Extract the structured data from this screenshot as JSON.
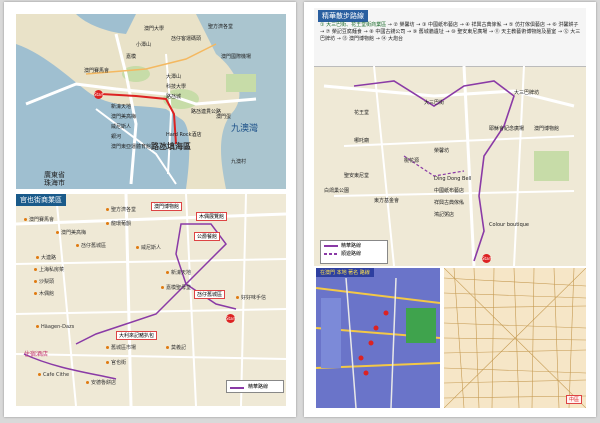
{
  "map1": {
    "sea_label": "九澳灣",
    "region_label_1": "廣東省",
    "region_label_2": "珠海市",
    "district_label": "路氹填海區",
    "places": [
      "澳門賽馬會",
      "氹仔客運碼頭",
      "澳門大學",
      "聖方濟各堂",
      "新濠天地",
      "澳門美高梅",
      "威尼斯人",
      "銀河",
      "Hard Rock酒店",
      "澳門國際機場",
      "大潭山",
      "科技大學",
      "路氹城",
      "九澳村",
      "嘉模",
      "小潭山",
      "澳門東亞運體育館",
      "路氹連貫公路",
      "澳門蛋"
    ],
    "start_label": "Start"
  },
  "map2": {
    "title": "官也街商業區",
    "places": [
      "澳門賽馬會",
      "澳門美高梅",
      "氹仔舊城區",
      "大連路",
      "上海私房菜",
      "沙梨頭",
      "木偶館",
      "Häagen-Dazs",
      "Cafe Cithe",
      "聖方濟各堂",
      "龍環葡韻",
      "威尼斯人",
      "新濠天地",
      "嘉模聖母堂",
      "大利來記豬扒包",
      "好好味手信",
      "舊城區市場",
      "莫義記",
      "官也街",
      "安德魯餅店"
    ],
    "boxed": [
      "澳門博物館",
      "木偶展覽館",
      "公爵餐館",
      "氹仔舊城區",
      "大利來記豬扒包"
    ],
    "hotel_label": "住宿酒店",
    "legend": "精華路線",
    "start_label": "Start"
  },
  "map3": {
    "title": "精華散步路線",
    "stops": [
      "大三巴街、花王堂街商業區",
      "榮馨坊",
      "中國紙布藝店",
      "祥興古典傢俬",
      "仿打傢俱藝店",
      "洪馨餅子",
      "榮記豆腐麵食",
      "中國古錢公司",
      "舊城牆遺址",
      "聖安東尼廣場",
      "天主教藝術博物館及墓室",
      "大三巴牌坊",
      "澳門博物館",
      "大炮台"
    ],
    "places": [
      "大三巴牌坊",
      "大三巴街",
      "花王堂",
      "耶穌會紀念廣場",
      "澳門博物館",
      "哪吒廟",
      "聖安東尼堂",
      "白鴿巢公園",
      "東方基金會",
      "Colour boutique",
      "Ding Dong Bell",
      "中國紙布藝店",
      "祥興古典傢俬",
      "鴻記粥店",
      "榮馨坊",
      "桃花源"
    ],
    "legend_1": "精華路線",
    "legend_2": "順遊路線",
    "start_label": "Start"
  },
  "map4": {
    "title": "在澳門 本地 著名 路線"
  },
  "map5": {
    "badge": "中區"
  }
}
